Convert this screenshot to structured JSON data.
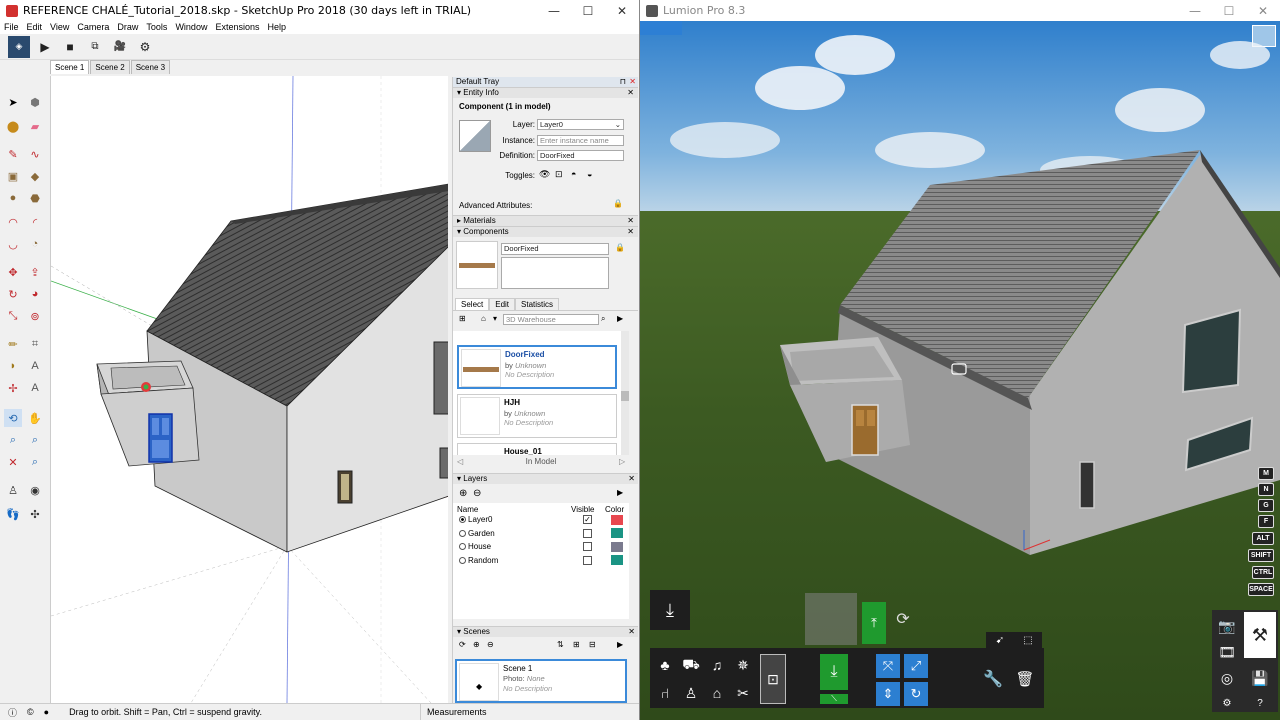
{
  "sketchup": {
    "title": "REFERENCE CHALÉ_Tutorial_2018.skp - SketchUp Pro 2018 (30 days left in TRIAL)",
    "window_controls": [
      "—",
      "☐",
      "✕"
    ],
    "menu": [
      "File",
      "Edit",
      "View",
      "Camera",
      "Draw",
      "Tools",
      "Window",
      "Extensions",
      "Help"
    ],
    "scenes_tabs": [
      "Scene 1",
      "Scene 2",
      "Scene 3"
    ],
    "tray": {
      "title": "Default Tray",
      "entity_info": {
        "header": "Entity Info",
        "component_label": "Component (1 in model)",
        "layer_label": "Layer:",
        "layer_value": "Layer0",
        "instance_label": "Instance:",
        "instance_placeholder": "Enter instance name",
        "definition_label": "Definition:",
        "definition_value": "DoorFixed",
        "toggles_label": "Toggles:",
        "advanced_label": "Advanced Attributes:"
      },
      "materials_header": "Materials",
      "components": {
        "header": "Components",
        "selected_name": "DoorFixed",
        "tabs": [
          "Select",
          "Edit",
          "Statistics"
        ],
        "search_placeholder": "3D Warehouse",
        "items": [
          {
            "name": "DoorFixed",
            "by": "by",
            "author": "Unknown",
            "desc": "No Description"
          },
          {
            "name": "HJH",
            "by": "by",
            "author": "Unknown",
            "desc": "No Description"
          },
          {
            "name": "House_01"
          }
        ],
        "in_model": "In Model"
      },
      "layers": {
        "header": "Layers",
        "col_name": "Name",
        "col_visible": "Visible",
        "col_color": "Color",
        "rows": [
          {
            "name": "Layer0",
            "active": true,
            "visible": true,
            "color": "#e8474f"
          },
          {
            "name": "Garden",
            "active": false,
            "visible": false,
            "color": "#1a9484"
          },
          {
            "name": "House",
            "active": false,
            "visible": false,
            "color": "#7a7a8e"
          },
          {
            "name": "Random",
            "active": false,
            "visible": false,
            "color": "#1a9484"
          }
        ]
      },
      "scenes": {
        "header": "Scenes",
        "item_name": "Scene 1",
        "item_photo_label": "Photo:",
        "item_photo_value": "None",
        "item_desc": "No Description"
      }
    },
    "status_text": "Drag to orbit. Shift = Pan, Ctrl = suspend gravity.",
    "measurements_label": "Measurements"
  },
  "lumion": {
    "title": "Lumion Pro 8.3",
    "window_controls": [
      "—",
      "☐",
      "✕"
    ],
    "keys": [
      "M",
      "N",
      "G",
      "F",
      "ALT",
      "SHIFT",
      "CTRL",
      "SPACE"
    ]
  },
  "colors": {
    "selection_blue": "#3b8ad9",
    "lumion_green": "#1f9a2e",
    "lumion_blue": "#2c7fd1"
  }
}
